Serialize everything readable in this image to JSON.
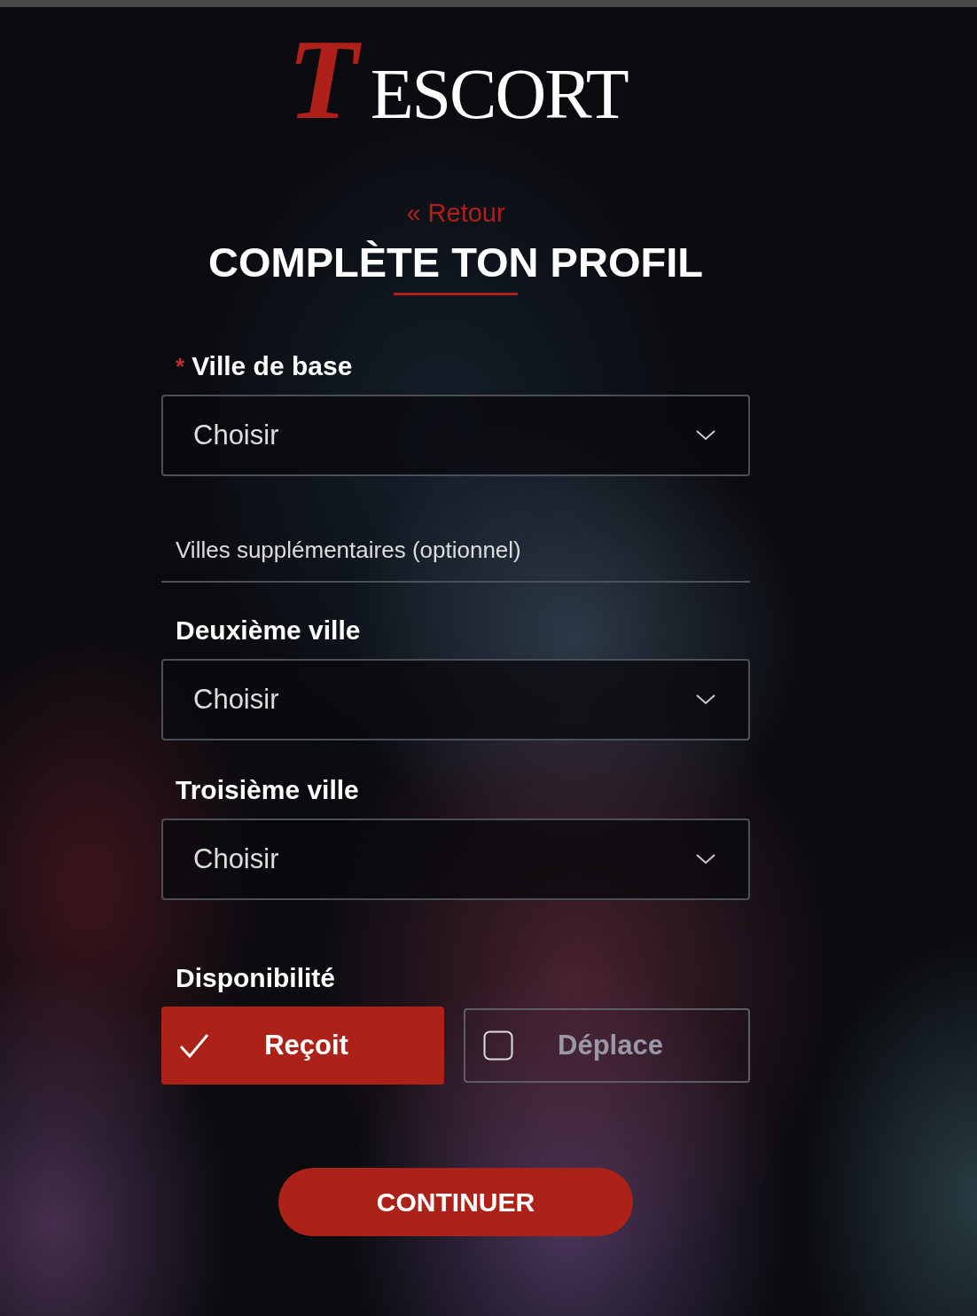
{
  "logo": {
    "mark": "T",
    "text": "ESCORT"
  },
  "back_link": "« Retour",
  "title": "COMPLÈTE TON PROFIL",
  "base_city": {
    "label": "Ville de base",
    "required_mark": "*",
    "value": "Choisir"
  },
  "extra_cities_heading": "Villes supplémentaires (optionnel)",
  "extra_cities": [
    {
      "label": "Deuxième ville",
      "value": "Choisir"
    },
    {
      "label": "Troisième ville",
      "value": "Choisir"
    }
  ],
  "availability": {
    "label": "Disponibilité",
    "options": [
      {
        "label": "Reçoit",
        "selected": true
      },
      {
        "label": "Déplace",
        "selected": false
      }
    ]
  },
  "continue_button": "CONTINUER"
}
